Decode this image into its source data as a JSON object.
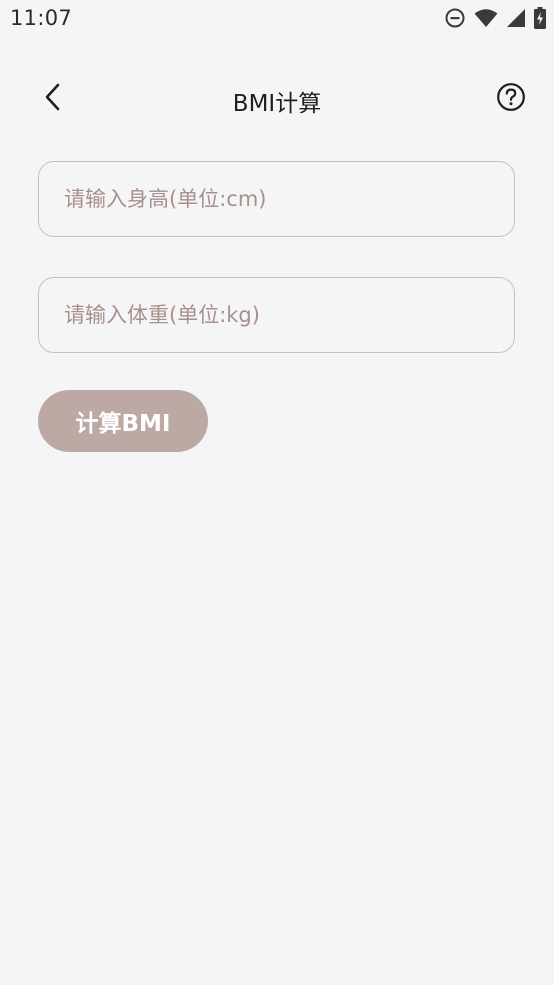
{
  "status_bar": {
    "time": "11:07",
    "icons": [
      "do-not-disturb-icon",
      "wifi-icon",
      "signal-icon",
      "battery-charging-icon"
    ]
  },
  "app_bar": {
    "title": "BMI计算",
    "back_icon": "chevron-left-icon",
    "help_icon": "help-circle-icon"
  },
  "form": {
    "height_placeholder": "请输入身高(单位:cm)",
    "height_value": "",
    "weight_placeholder": "请输入体重(单位:kg)",
    "weight_value": "",
    "calculate_label": "计算BMI"
  },
  "colors": {
    "background": "#f5f5f7",
    "field_border": "#cdbfbc",
    "placeholder": "#a8908b",
    "button": "#bca9a4",
    "button_text": "#ffffff"
  }
}
